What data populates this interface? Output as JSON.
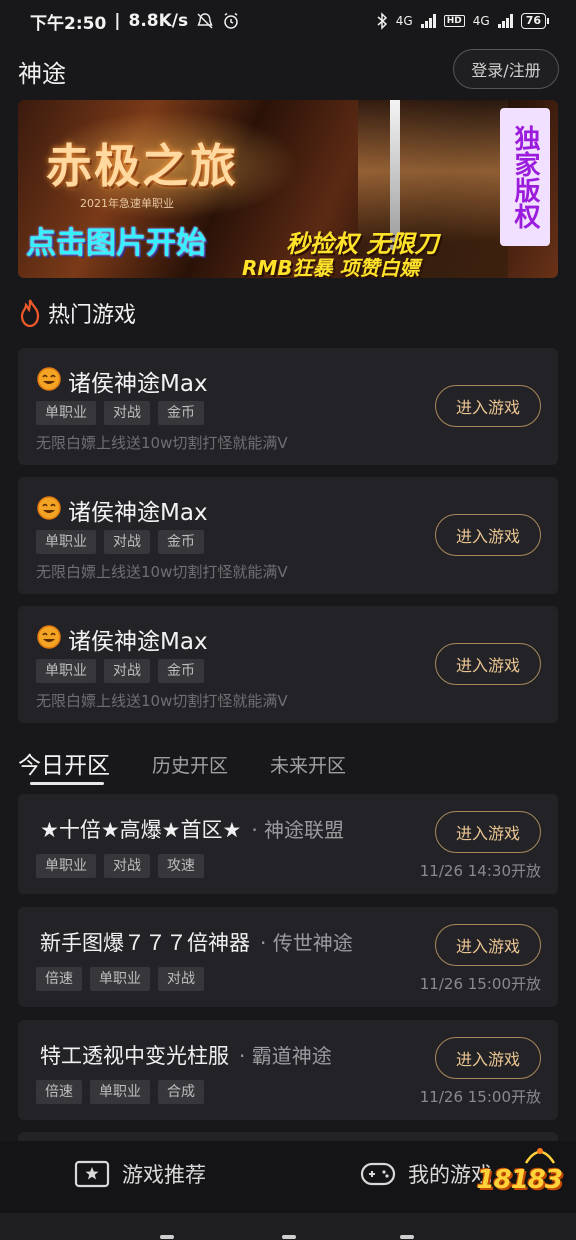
{
  "status_bar": {
    "time": "下午2:50",
    "speed": "8.8K/s",
    "net1": "4G",
    "hd": "HD",
    "net2": "4G",
    "battery": "76"
  },
  "header": {
    "title": "神途",
    "login_label": "登录/注册"
  },
  "banner": {
    "title": "赤极之旅",
    "subtitle": "2021年急速单职业",
    "cta": "点击图片开始",
    "slogan1": "秒捡权 无限刀",
    "slogan2": "RMB狂暴 项赞白嫖",
    "badge": "独家版权"
  },
  "hot_section": {
    "label": "热门游戏",
    "games": [
      {
        "name": "诸侯神途Max",
        "tags": [
          "单职业",
          "对战",
          "金币"
        ],
        "desc": "无限白嫖上线送10w切割打怪就能满V",
        "button": "进入游戏"
      },
      {
        "name": "诸侯神途Max",
        "tags": [
          "单职业",
          "对战",
          "金币"
        ],
        "desc": "无限白嫖上线送10w切割打怪就能满V",
        "button": "进入游戏"
      },
      {
        "name": "诸侯神途Max",
        "tags": [
          "单职业",
          "对战",
          "金币"
        ],
        "desc": "无限白嫖上线送10w切割打怪就能满V",
        "button": "进入游戏"
      }
    ]
  },
  "tabs": [
    "今日开区",
    "历史开区",
    "未来开区"
  ],
  "servers": [
    {
      "title": "★十倍★高爆★首区★",
      "game": "· 神途联盟",
      "tags": [
        "单职业",
        "对战",
        "攻速"
      ],
      "time": "11/26 14:30开放",
      "button": "进入游戏"
    },
    {
      "title": "新手图爆７７７倍神器",
      "game": "· 传世神途",
      "tags": [
        "倍速",
        "单职业",
        "对战"
      ],
      "time": "11/26 15:00开放",
      "button": "进入游戏"
    },
    {
      "title": "特工透视中变光柱服",
      "game": "· 霸道神途",
      "tags": [
        "倍速",
        "单职业",
        "合成"
      ],
      "time": "11/26 15:00开放",
      "button": "进入游戏"
    }
  ],
  "bottom_nav": {
    "recommend": "游戏推荐",
    "mine": "我的游戏",
    "logo": "18183"
  },
  "colors": {
    "background": "#18181a",
    "card": "#232327",
    "accent_gold": "#eac592",
    "fire": "#f05a2a"
  }
}
